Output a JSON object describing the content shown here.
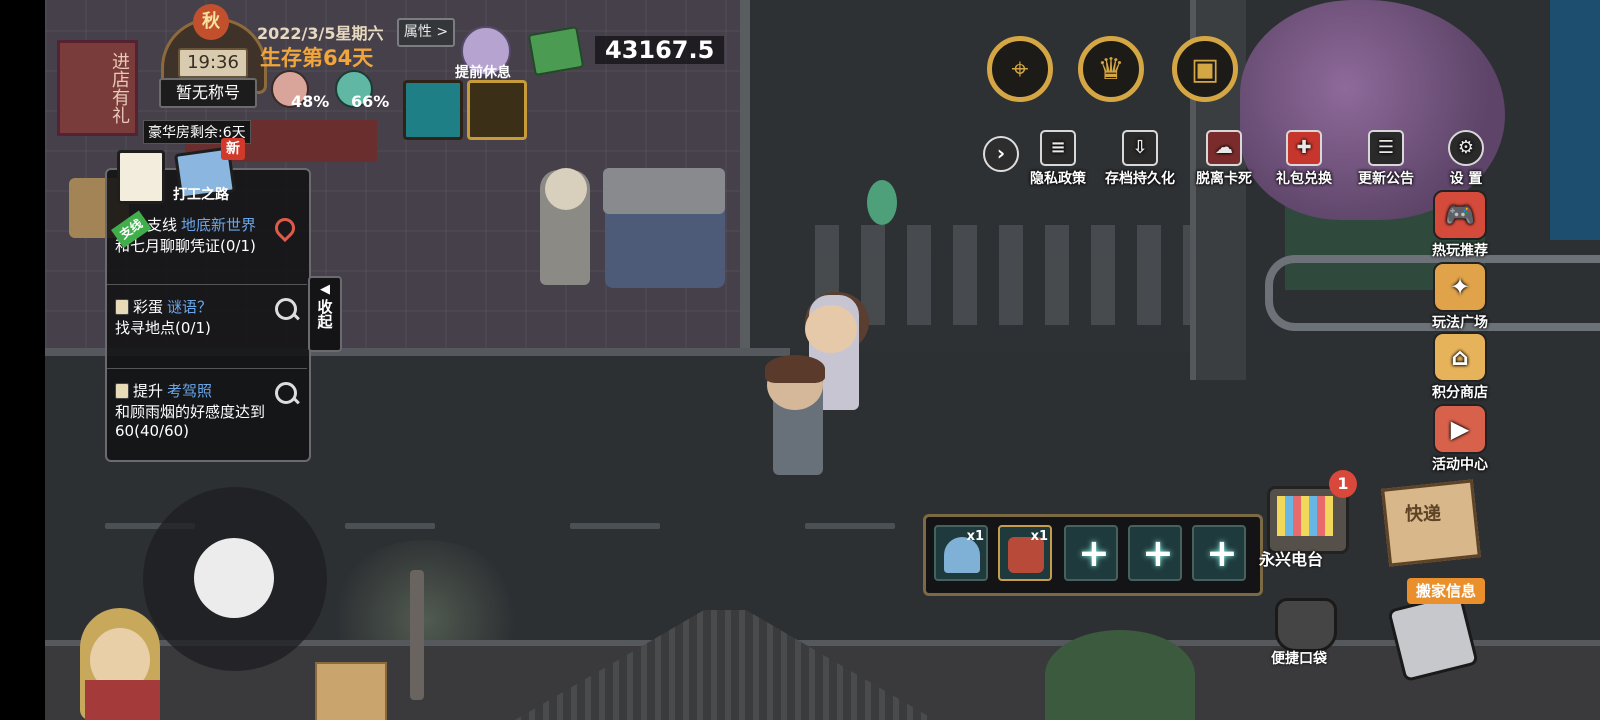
{
  "hud": {
    "season": "秋",
    "clock": "19:36",
    "title_badge": "暂无称号",
    "date": "2022/3/5星期六",
    "survival_days": "生存第64天",
    "attributes_button": "属性 >",
    "hunger_percent": "48%",
    "health_percent": "66%",
    "rest_label": "提前休息",
    "money": "43167.5",
    "luxury_room": "豪华房剩余:6天"
  },
  "quest_panel": {
    "new_badge": "新",
    "work_road_label": "打工之路",
    "collapse_label": "收起",
    "quests": [
      {
        "tag": "支线",
        "prefix": "支线 ",
        "keyword": "地底新世界",
        "desc": "和七月聊聊凭证(0/1)"
      },
      {
        "prefix": "彩蛋 ",
        "keyword": "谜语？",
        "desc": "找寻地点(0/1)"
      },
      {
        "prefix": "提升 ",
        "keyword": "考驾照",
        "desc": "和顾雨烟的好感度达到60(40/60)"
      }
    ]
  },
  "top_icons": [
    "map-pin-icon",
    "trophy-icon",
    "backpack-icon"
  ],
  "top_menu": [
    {
      "label": "隐私政策",
      "icon": "document-icon"
    },
    {
      "label": "存档持久化",
      "icon": "save-icon"
    },
    {
      "label": "脱离卡死",
      "icon": "unstuck-icon"
    },
    {
      "label": "礼包兑换",
      "icon": "gift-icon"
    },
    {
      "label": "更新公告",
      "icon": "notice-icon"
    },
    {
      "label": "设 置",
      "icon": "gear-icon"
    }
  ],
  "side_menu": [
    {
      "label": "热玩推荐",
      "icon": "gamepad-icon"
    },
    {
      "label": "玩法广场",
      "icon": "plaza-icon"
    },
    {
      "label": "积分商店",
      "icon": "shop-icon"
    },
    {
      "label": "活动中心",
      "icon": "tv-play-icon"
    }
  ],
  "hotbar": {
    "slots": [
      {
        "type": "item",
        "icon": "shell-icon",
        "count": "x1"
      },
      {
        "type": "item",
        "icon": "jar-icon",
        "count": "x1"
      },
      {
        "type": "empty",
        "plus": "+"
      },
      {
        "type": "empty",
        "plus": "+"
      },
      {
        "type": "empty",
        "plus": "+"
      }
    ]
  },
  "right_bottom": {
    "radio_label": "永兴电台",
    "radio_notification": "1",
    "express_box_label": "快递",
    "pocket_label": "便捷口袋",
    "move_info_label": "搬家信息"
  },
  "world": {
    "shop_sign": "进店有礼"
  },
  "colors": {
    "accent_gold": "#d5a644",
    "survival_orange": "#f1a53a",
    "quest_keyword_blue": "#6aa6e8",
    "notification_red": "#d9483b"
  }
}
